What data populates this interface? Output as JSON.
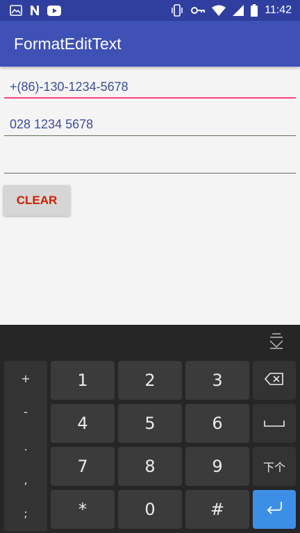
{
  "status_bar": {
    "time": "11:42",
    "left_icons": [
      "image-icon",
      "n-icon",
      "youtube-icon"
    ],
    "right_icons": [
      "vibrate-icon",
      "key-icon",
      "wifi-icon",
      "signal-icon",
      "battery-icon"
    ]
  },
  "app_bar": {
    "title": "FormatEditText"
  },
  "fields": [
    {
      "value": "+(86)-130-1234-5678",
      "focused": true
    },
    {
      "value": "028 1234 5678",
      "focused": false
    },
    {
      "value": "",
      "focused": false
    }
  ],
  "clear_button": {
    "label": "CLEAR"
  },
  "keyboard": {
    "symbols": [
      "+",
      "-",
      ".",
      ",",
      ";"
    ],
    "rows": [
      [
        "1",
        "2",
        "3"
      ],
      [
        "4",
        "5",
        "6"
      ],
      [
        "7",
        "8",
        "9"
      ],
      [
        "*",
        "0",
        "#"
      ]
    ],
    "next_key_label": "下个",
    "colors": {
      "background": "#262626",
      "key": "#3b3b3b",
      "enter": "#3d8fe6"
    }
  }
}
